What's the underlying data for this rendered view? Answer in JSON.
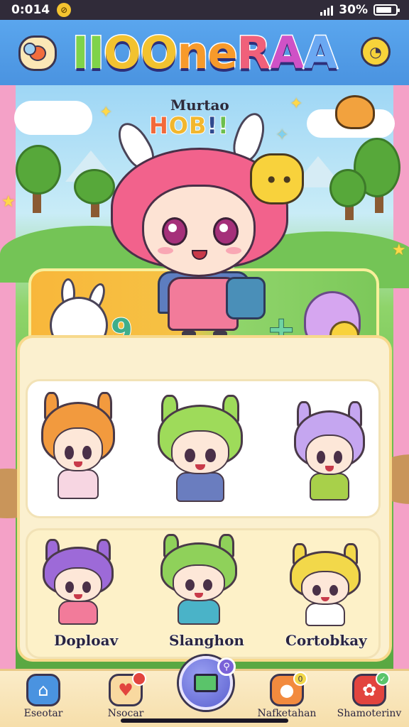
{
  "status_bar": {
    "time": "0:014",
    "battery": "30%",
    "battery_level": 0.8
  },
  "header": {
    "logo_parts": [
      "II",
      "OO",
      "ne",
      "R",
      "A",
      "A"
    ]
  },
  "hero": {
    "subtitle": "Murtao",
    "title_parts": [
      "H",
      "OB",
      "!",
      "!"
    ],
    "glyph_left": "9",
    "glyph_right": "+"
  },
  "characters": [
    {
      "label": "Doploav",
      "hair": "#9d6ad8",
      "outfit": "#f27b9a"
    },
    {
      "label": "Slanghon",
      "hair": "#8fd15a",
      "outfit": "#4ab3c8"
    },
    {
      "label": "Cortobkay",
      "hair": "#f2d84a",
      "outfit": "#ffffff"
    }
  ],
  "featured": [
    {
      "hair": "#f29a3e",
      "outfit": "#f7d6e2"
    },
    {
      "hair": "#9edb5a",
      "outfit": "#6a7dbf"
    },
    {
      "hair": "#c5a6f0",
      "outfit": "#a8d04a"
    }
  ],
  "tabs": [
    {
      "label": "Eseotar",
      "icon": "home-icon",
      "color": "#4a93e0",
      "badge": ""
    },
    {
      "label": "Nsocar",
      "icon": "heart-icon",
      "color": "#f2a24a",
      "badge": ""
    },
    {
      "label": "Nafketahan",
      "icon": "mascot-icon",
      "color": "#f28a3e",
      "badge": "0"
    },
    {
      "label": "Shamoterinv",
      "icon": "gift-icon",
      "color": "#e2443e",
      "badge": ""
    }
  ],
  "center_button": {
    "icon": "screen-icon",
    "badge_icon": "search-icon"
  },
  "colors": {
    "header_blue": "#4a93e0",
    "panel_cream": "#fbf0cf",
    "hero_pink": "#f2628c"
  }
}
